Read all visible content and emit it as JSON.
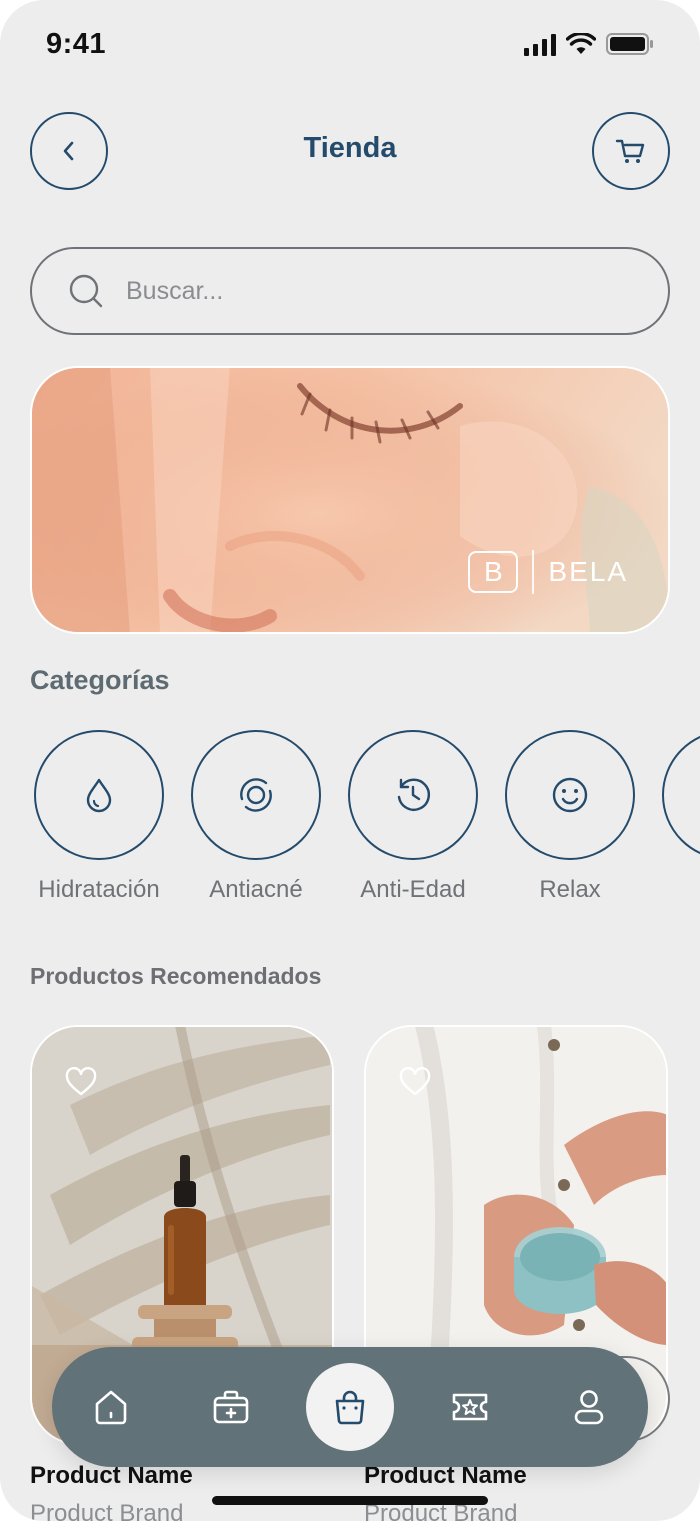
{
  "status_bar": {
    "time": "9:41"
  },
  "header": {
    "title": "Tienda"
  },
  "search": {
    "placeholder": "Buscar..."
  },
  "banner": {
    "brand_mark": "B",
    "brand_name": "BELA"
  },
  "categories": {
    "title": "Categorías",
    "items": [
      {
        "label": "Hidratación",
        "icon": "drop-icon"
      },
      {
        "label": "Antiacné",
        "icon": "target-icon"
      },
      {
        "label": "Anti-Edad",
        "icon": "history-clock-icon"
      },
      {
        "label": "Relax",
        "icon": "smile-icon"
      },
      {
        "label": "",
        "icon": "partial-category-icon"
      }
    ]
  },
  "products": {
    "title": "Productos Recomendados",
    "items": [
      {
        "name": "Product Name",
        "brand": "Product Brand"
      },
      {
        "name": "Product Name",
        "brand": "Product Brand"
      }
    ]
  },
  "tab_bar": {
    "items": [
      {
        "icon": "home-icon",
        "active": false
      },
      {
        "icon": "medical-kit-icon",
        "active": false
      },
      {
        "icon": "shopping-bag-icon",
        "active": true
      },
      {
        "icon": "ticket-star-icon",
        "active": false
      },
      {
        "icon": "user-icon",
        "active": false
      }
    ]
  },
  "colors": {
    "accent": "#244b6b",
    "background": "#ededed",
    "tab_bar": "#627279",
    "muted_text": "#6f7276"
  }
}
